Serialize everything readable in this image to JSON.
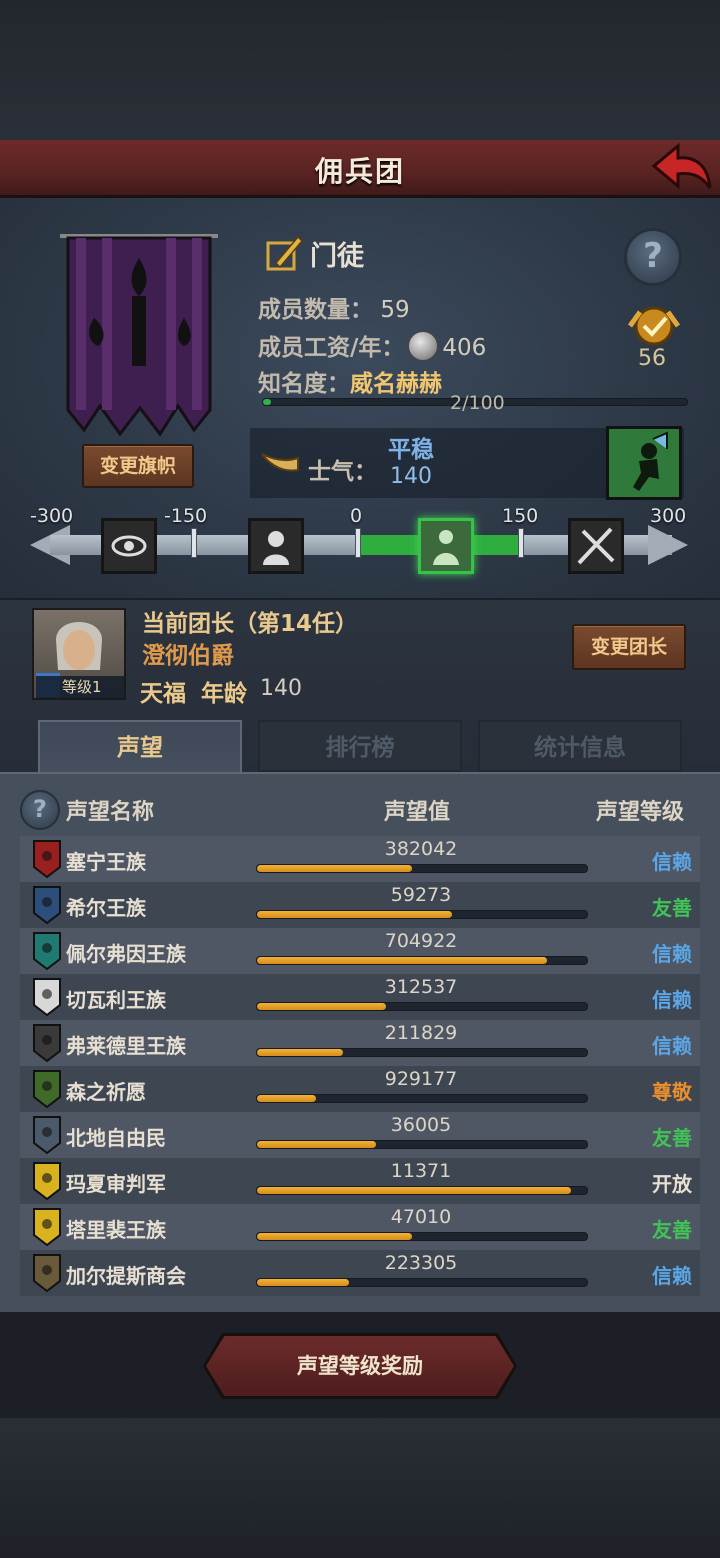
{
  "header": {
    "title": "佣兵团"
  },
  "banner": {
    "change_label": "变更旗帜"
  },
  "rank": {
    "label": "门徒"
  },
  "stats": {
    "members_label": "成员数量：",
    "members_value": "59",
    "wage_label": "成员工资/年：",
    "wage_value": "406",
    "fame_label": "知名度：",
    "fame_value": "威名赫赫",
    "fame_progress": "2/100",
    "fame_fraction": 0.02
  },
  "badge": {
    "count": "56"
  },
  "morale": {
    "label": "士气：",
    "state": "平稳",
    "value": "140",
    "scale": [
      "-300",
      "-150",
      "0",
      "150",
      "300"
    ]
  },
  "leader": {
    "title": "当前团长（第14任）",
    "name": "澄彻伯爵",
    "level": "等级1",
    "trait": "天福",
    "age_label": "年龄",
    "age": "140",
    "change_label": "变更团长"
  },
  "tabs": [
    {
      "label": "声望",
      "active": true
    },
    {
      "label": "排行榜",
      "active": false
    },
    {
      "label": "统计信息",
      "active": false
    }
  ],
  "reputation": {
    "col_name": "声望名称",
    "col_value": "声望值",
    "col_level": "声望等级",
    "rows": [
      {
        "name": "塞宁王族",
        "value": "382042",
        "fill": 0.47,
        "level": "信赖",
        "level_color": "#5aa6e6",
        "crest": "#9a1f1f"
      },
      {
        "name": "希尔王族",
        "value": "59273",
        "fill": 0.59,
        "level": "友善",
        "level_color": "#41c257",
        "crest": "#2b4f7a"
      },
      {
        "name": "佩尔弗因王族",
        "value": "704922",
        "fill": 0.88,
        "level": "信赖",
        "level_color": "#5aa6e6",
        "crest": "#1f7a72"
      },
      {
        "name": "切瓦利王族",
        "value": "312537",
        "fill": 0.39,
        "level": "信赖",
        "level_color": "#5aa6e6",
        "crest": "#d8d8d8"
      },
      {
        "name": "弗莱德里王族",
        "value": "211829",
        "fill": 0.26,
        "level": "信赖",
        "level_color": "#5aa6e6",
        "crest": "#3a3a3a"
      },
      {
        "name": "森之祈愿",
        "value": "929177",
        "fill": 0.18,
        "level": "尊敬",
        "level_color": "#e98e2c",
        "crest": "#3f6a2a"
      },
      {
        "name": "北地自由民",
        "value": "36005",
        "fill": 0.36,
        "level": "友善",
        "level_color": "#41c257",
        "crest": "#4a5a6a"
      },
      {
        "name": "玛夏审判军",
        "value": "11371",
        "fill": 0.95,
        "level": "开放",
        "level_color": "#e6dfd2",
        "crest": "#d8b21f"
      },
      {
        "name": "塔里裴王族",
        "value": "47010",
        "fill": 0.47,
        "level": "友善",
        "level_color": "#41c257",
        "crest": "#d8b21f"
      },
      {
        "name": "加尔提斯商会",
        "value": "223305",
        "fill": 0.28,
        "level": "信赖",
        "level_color": "#5aa6e6",
        "crest": "#6a5a3a"
      }
    ]
  },
  "footer": {
    "reward_label": "声望等级奖励"
  }
}
